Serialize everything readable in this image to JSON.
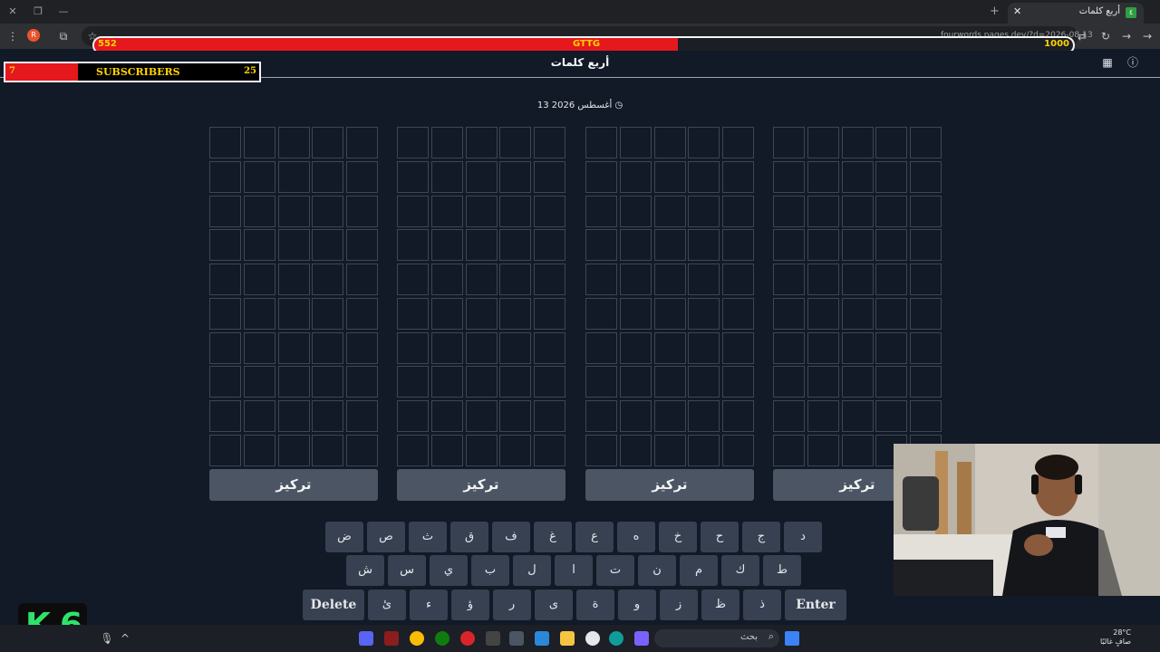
{
  "browser": {
    "tab_title": "أربع كلمات",
    "url": "fourwords.pages.dev/?d=2026-08-13",
    "profile_initial": "R"
  },
  "stream_bar": {
    "left_value": "552",
    "center_label": "GTTG",
    "right_value": "1000",
    "progress": 0.552
  },
  "subscribers": {
    "current": "7",
    "label": "SUBSCRIBERS",
    "goal": "25"
  },
  "app": {
    "title": "أربع كلمات",
    "date": "13 أغسطس 2026"
  },
  "boards": [
    {
      "button": "تركيز"
    },
    {
      "button": "تركيز"
    },
    {
      "button": "تركيز"
    },
    {
      "button": "تركيز"
    }
  ],
  "keyboard": {
    "row1": [
      "ض",
      "ص",
      "ث",
      "ق",
      "ف",
      "غ",
      "ع",
      "ه",
      "خ",
      "ح",
      "ج",
      "د"
    ],
    "row2": [
      "ش",
      "س",
      "ي",
      "ب",
      "ل",
      "ا",
      "ت",
      "ن",
      "م",
      "ك",
      "ط"
    ],
    "row3": [
      "Delete",
      "ئ",
      "ء",
      "ؤ",
      "ر",
      "ى",
      "ة",
      "و",
      "ز",
      "ظ",
      "ذ",
      "Enter"
    ]
  },
  "overlay": {
    "logo_left": "K",
    "logo_right": "6"
  },
  "taskbar": {
    "search_text": "بحث",
    "temperature": "28°C",
    "weather_text": "صافٍ غالبًا"
  },
  "colors": {
    "background": "#121927",
    "stream_fill": "#e5181e",
    "stream_text": "#ffd400",
    "key": "#374151",
    "focus_button": "#4b5563"
  }
}
